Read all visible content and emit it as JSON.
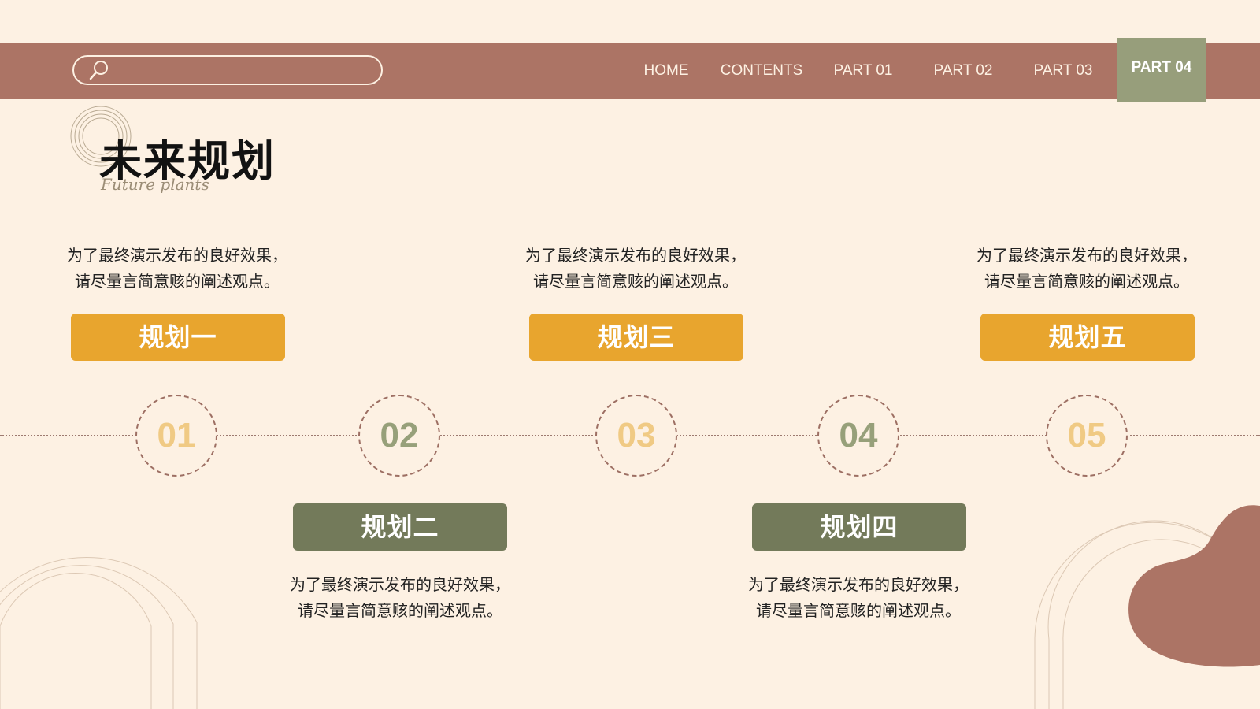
{
  "colors": {
    "background": "#fdf1e3",
    "navbar": "#ac7465",
    "nav_active": "#979e7b",
    "orange": "#e8a52e",
    "green": "#737a5a",
    "num_orange": "#f0ca84",
    "num_green": "#97a07a"
  },
  "search": {
    "icon": "search-icon",
    "value": ""
  },
  "nav": {
    "items": [
      "HOME",
      "CONTENTS",
      "PART 01",
      "PART 02",
      "PART 03",
      "PART 04"
    ],
    "active": "PART 04"
  },
  "heading": {
    "title": "未来规划",
    "subtitle": "Future plants"
  },
  "plans": [
    {
      "number": "01",
      "label": "规划一",
      "desc": [
        "为了最终演示发布的良好效果，",
        "请尽量言简意赅的阐述观点。"
      ]
    },
    {
      "number": "02",
      "label": "规划二",
      "desc": [
        "为了最终演示发布的良好效果，",
        "请尽量言简意赅的阐述观点。"
      ]
    },
    {
      "number": "03",
      "label": "规划三",
      "desc": [
        "为了最终演示发布的良好效果，",
        "请尽量言简意赅的阐述观点。"
      ]
    },
    {
      "number": "04",
      "label": "规划四",
      "desc": [
        "为了最终演示发布的良好效果，",
        "请尽量言简意赅的阐述观点。"
      ]
    },
    {
      "number": "05",
      "label": "规划五",
      "desc": [
        "为了最终演示发布的良好效果，",
        "请尽量言简意赅的阐述观点。"
      ]
    }
  ]
}
